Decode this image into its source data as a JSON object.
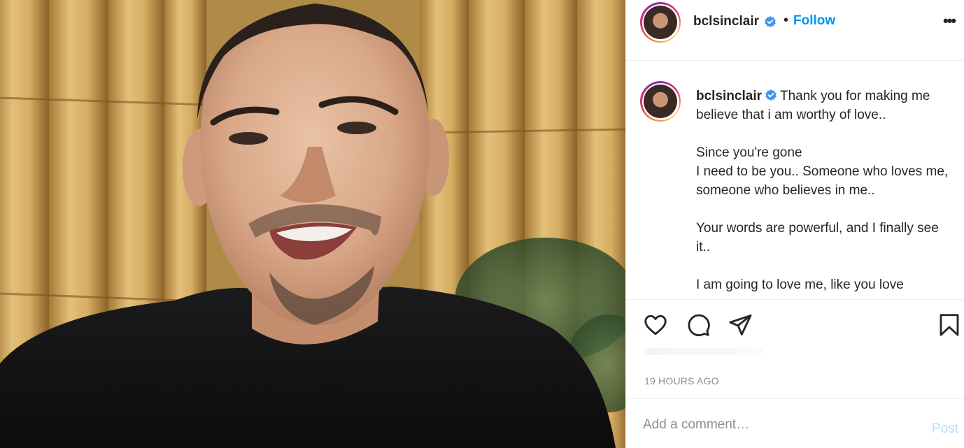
{
  "header": {
    "username": "bclsinclair",
    "separator": "•",
    "follow_label": "Follow",
    "more_label": "•••"
  },
  "caption": {
    "username": "bclsinclair",
    "lines": [
      "Thank you for making me believe that i am worthy of love..",
      "Since you're gone",
      "I need to be you.. Someone who loves me, someone who believes in me..",
      "Your words are powerful, and I finally see it..",
      "I am going to love me, like you love"
    ]
  },
  "icons": {
    "verified": "verified-badge-icon",
    "like": "heart-icon",
    "comment": "comment-bubble-icon",
    "share": "paper-plane-icon",
    "save": "bookmark-icon"
  },
  "post": {
    "timestamp": "19 HOURS AGO"
  },
  "comment": {
    "placeholder": "Add a comment…",
    "post_label": "Post"
  },
  "colors": {
    "accent": "#0095f6",
    "post_disabled": "#b2dffc",
    "muted": "#8e8e8e"
  }
}
